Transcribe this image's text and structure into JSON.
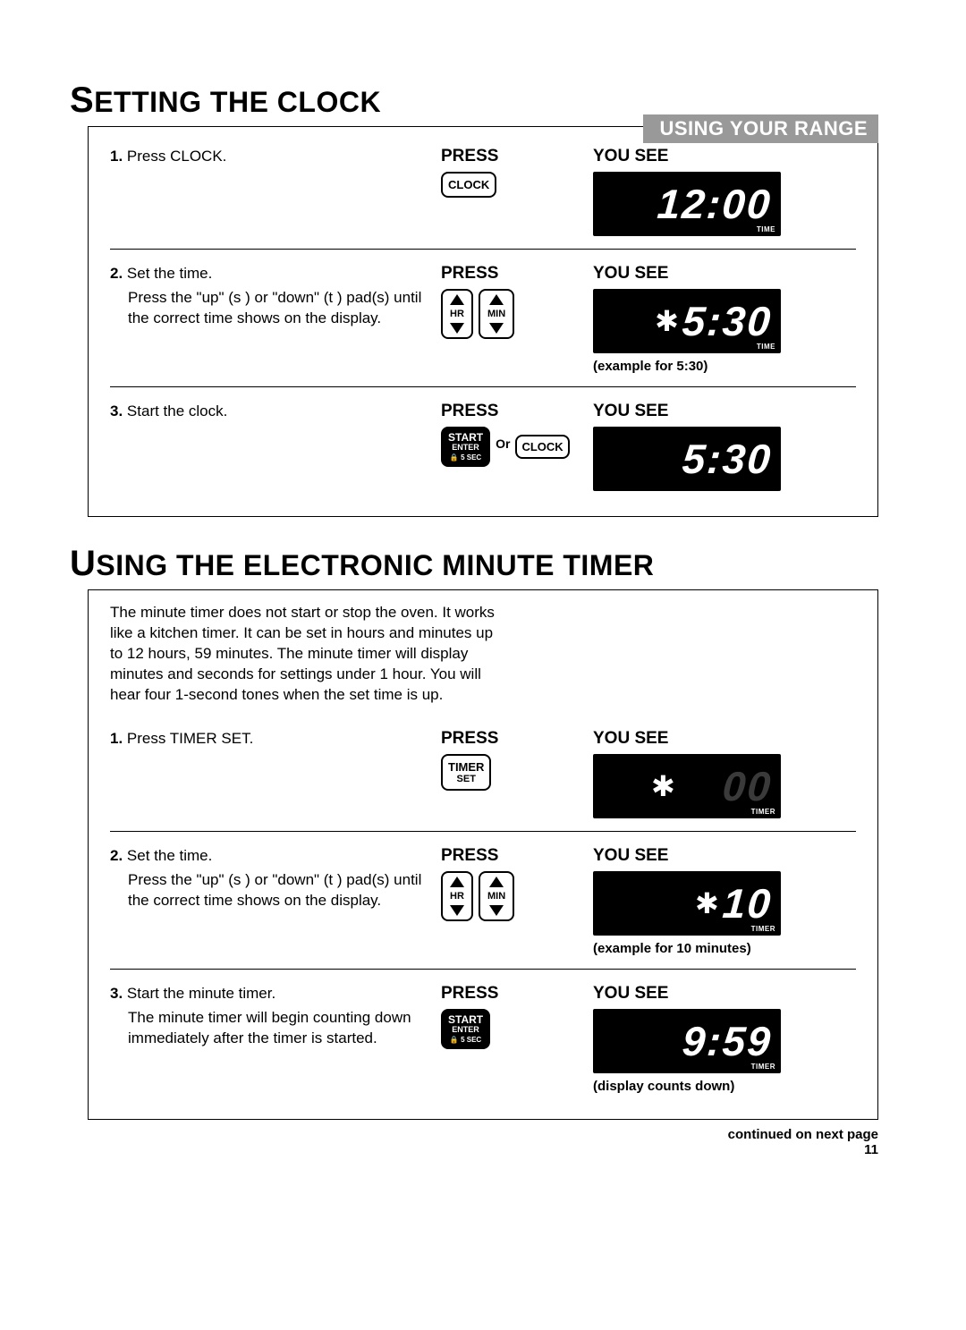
{
  "header": {
    "tab": "USING YOUR RANGE"
  },
  "section1": {
    "title_cap": "S",
    "title_rest": "ETTING THE CLOCK",
    "steps": [
      {
        "num": "1.",
        "text": "Press CLOCK.",
        "sub": "",
        "press_label": "PRESS",
        "yousee_label": "YOU SEE",
        "btn": "CLOCK",
        "display": "12:00",
        "display_sub": "TIME",
        "caption": ""
      },
      {
        "num": "2.",
        "text": "Set the time.",
        "sub": "Press the \"up\" (s ) or \"down\" (t ) pad(s) until the correct time shows on the display.",
        "press_label": "PRESS",
        "yousee_label": "YOU SEE",
        "hr": "HR",
        "min": "MIN",
        "display": "5:30",
        "display_sub": "TIME",
        "caption": "(example for 5:30)"
      },
      {
        "num": "3.",
        "text": "Start the clock.",
        "sub": "",
        "press_label": "PRESS",
        "yousee_label": "YOU SEE",
        "start": "START",
        "enter": "ENTER",
        "lock": "🔒 5 SEC",
        "or": "Or",
        "clock": "CLOCK",
        "display": "5:30",
        "display_sub": "",
        "caption": ""
      }
    ]
  },
  "section2": {
    "title_cap": "U",
    "title_rest": "SING THE ELECTRONIC MINUTE TIMER",
    "intro": "The minute timer does not start or stop the oven. It works like a kitchen timer. It can be set in hours and minutes up to 12 hours, 59 minutes. The minute timer will display minutes and seconds for settings under 1 hour. You will hear four 1-second tones when the set time is up.",
    "steps": [
      {
        "num": "1.",
        "text": "Press TIMER SET.",
        "sub": "",
        "press_label": "PRESS",
        "yousee_label": "YOU SEE",
        "btn1": "TIMER",
        "btn2": "SET",
        "display_ghost": "00",
        "display_sub": "TIMER",
        "snow": "✱",
        "caption": ""
      },
      {
        "num": "2.",
        "text": "Set the time.",
        "sub": "Press the \"up\" (s ) or \"down\" (t ) pad(s) until the correct time shows on the display.",
        "press_label": "PRESS",
        "yousee_label": "YOU SEE",
        "hr": "HR",
        "min": "MIN",
        "display": "10",
        "display_sub": "TIMER",
        "snow": "✱",
        "caption": "(example for 10 minutes)"
      },
      {
        "num": "3.",
        "text": "Start the minute timer.",
        "sub": "The minute timer will begin counting down immediately after the timer is started.",
        "press_label": "PRESS",
        "yousee_label": "YOU SEE",
        "start": "START",
        "enter": "ENTER",
        "lock": "🔒 5 SEC",
        "display": "9:59",
        "display_sub": "TIMER",
        "caption": "(display counts down)"
      }
    ]
  },
  "footer": {
    "continued": "continued on next page",
    "page": "11"
  }
}
